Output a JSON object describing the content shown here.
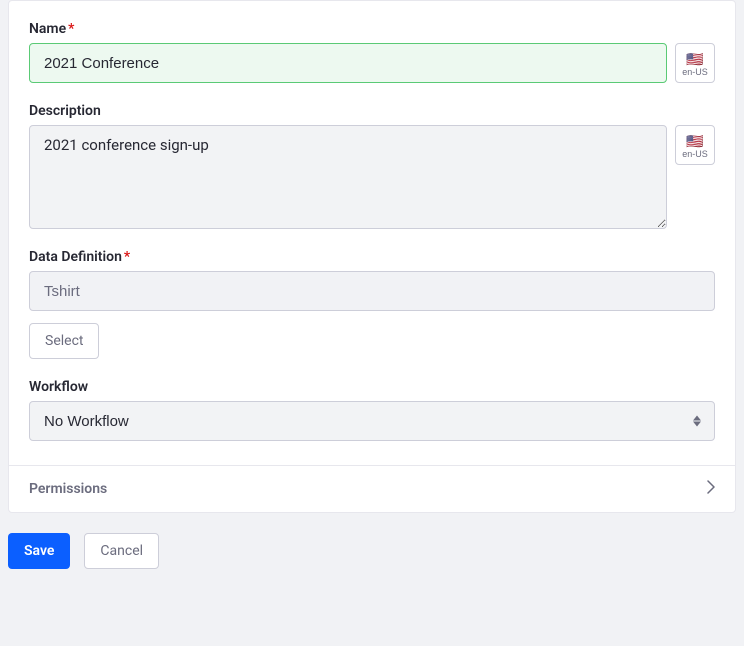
{
  "labels": {
    "name": "Name",
    "description": "Description",
    "data_definition": "Data Definition",
    "workflow": "Workflow"
  },
  "fields": {
    "name_value": "2021 Conference",
    "description_value": "2021 conference sign-up",
    "data_definition_value": "Tshirt",
    "workflow_selected": "No Workflow"
  },
  "locale": {
    "flag": "🇺🇸",
    "code": "en-US"
  },
  "buttons": {
    "select": "Select",
    "save": "Save",
    "cancel": "Cancel"
  },
  "sections": {
    "permissions": "Permissions"
  }
}
